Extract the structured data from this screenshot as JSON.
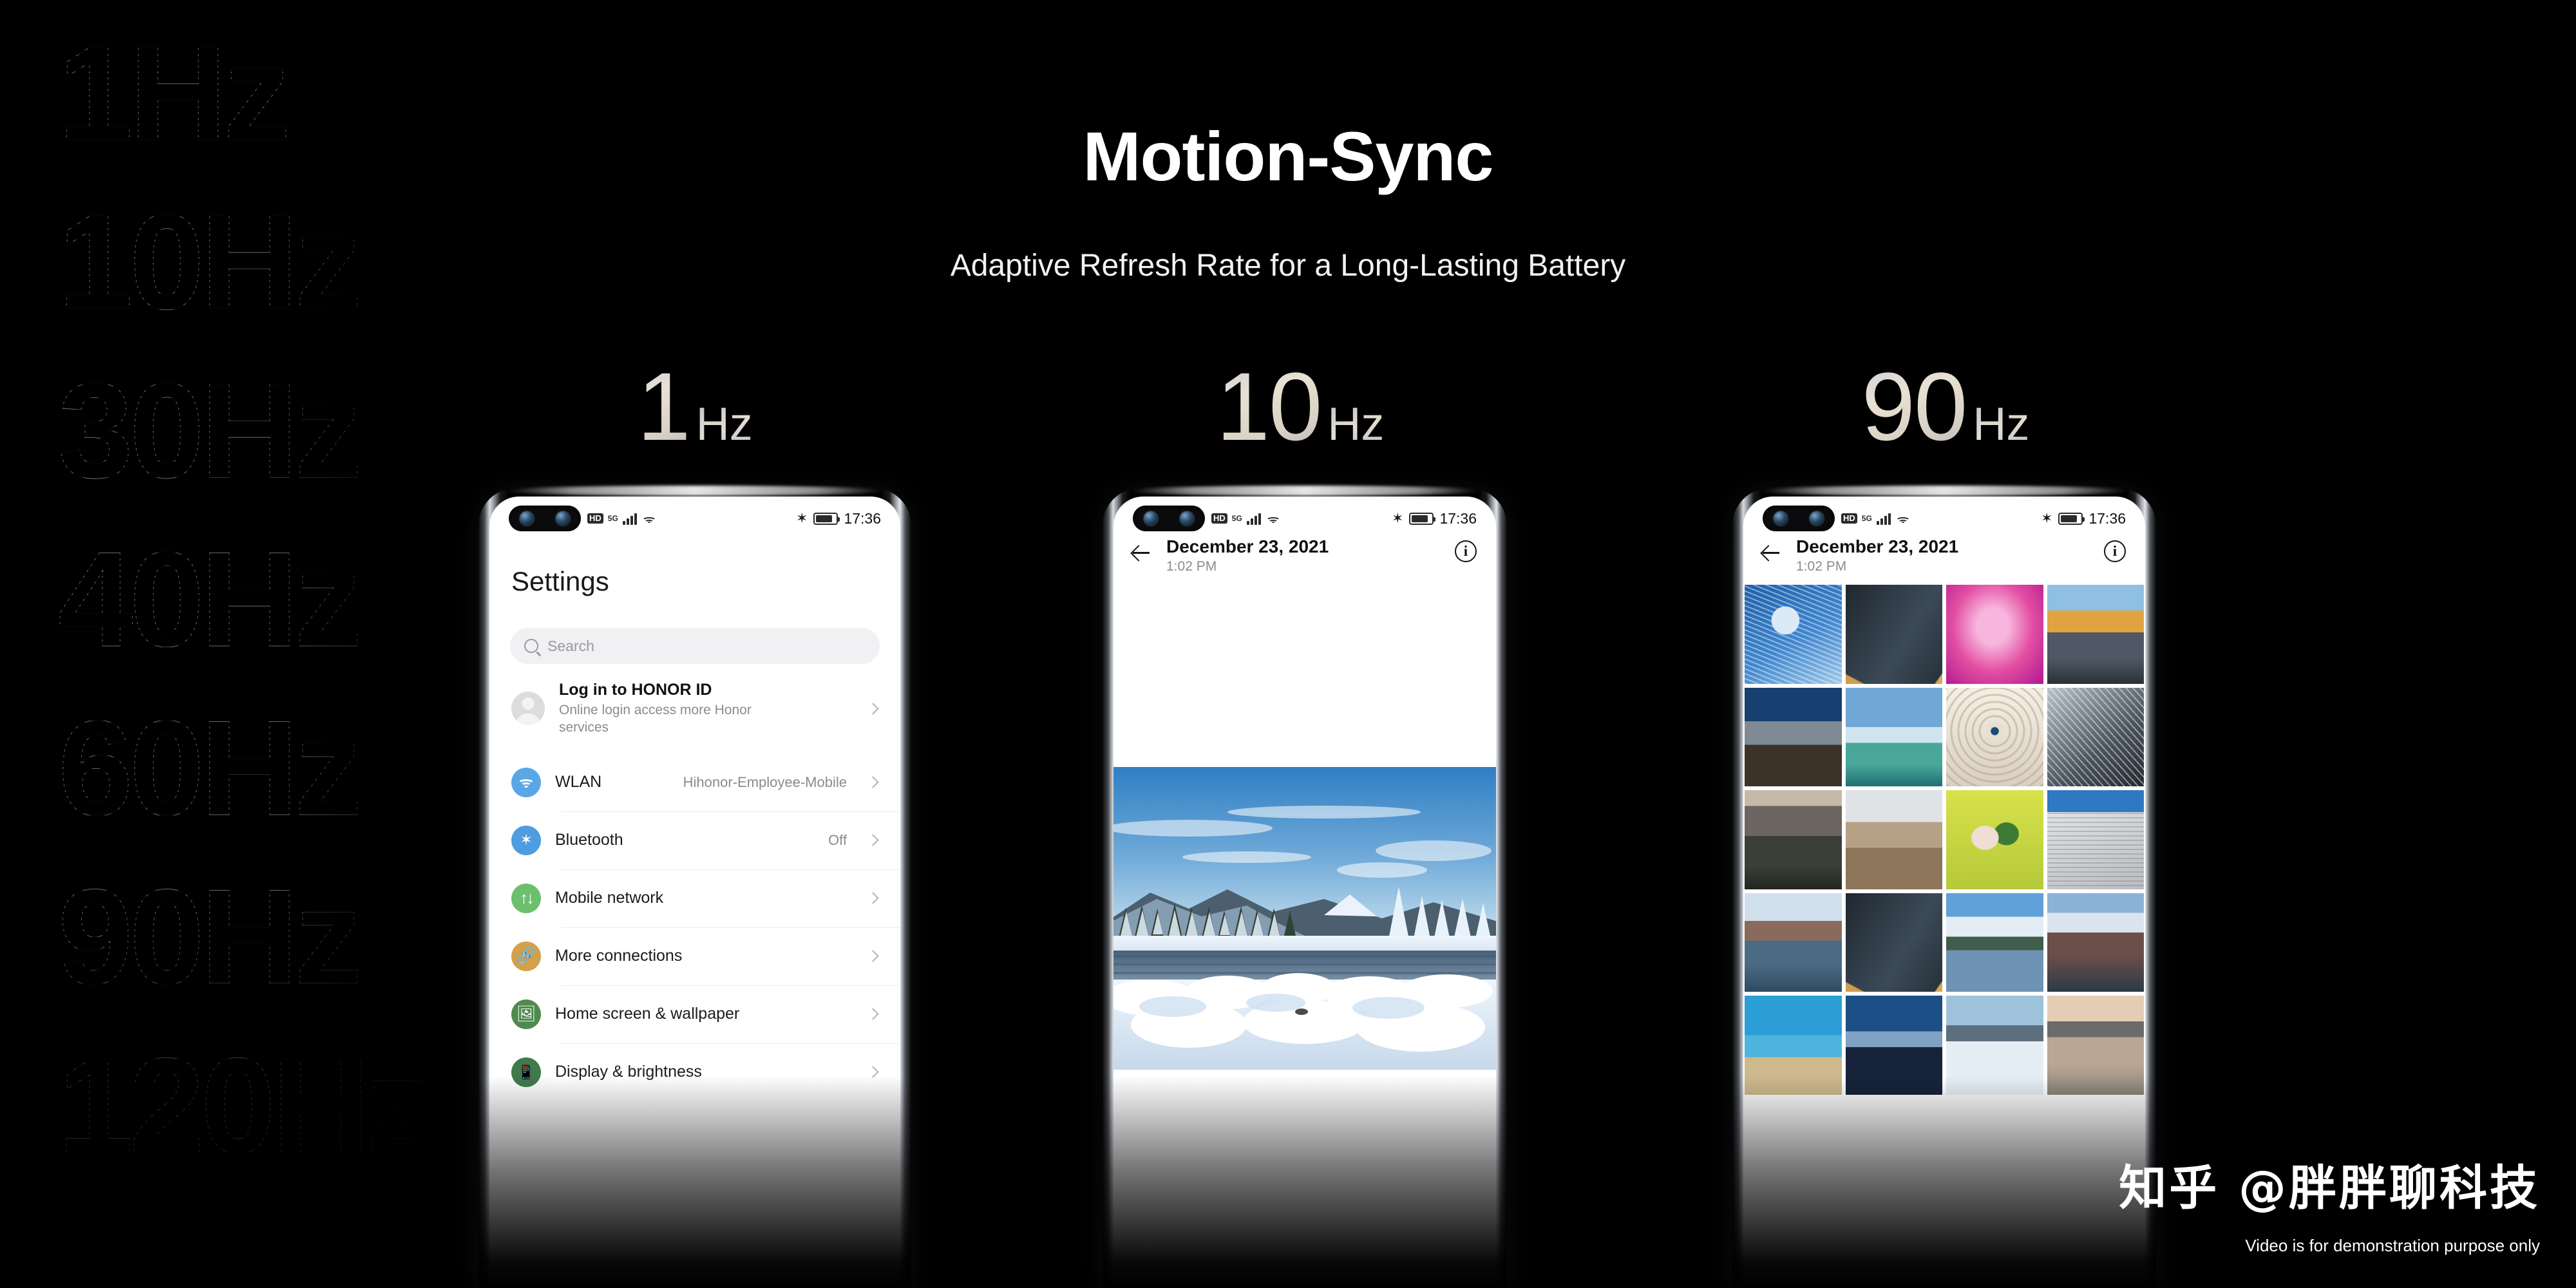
{
  "page": {
    "background": "#000000",
    "headline": "Motion-Sync",
    "subheadline": "Adaptive Refresh Rate for a Long-Lasting Battery",
    "watermark": "知乎 @胖胖聊科技",
    "disclaimer": "Video is for demonstration purpose only"
  },
  "decorative_rates": [
    {
      "label": "1Hz"
    },
    {
      "label": "10Hz"
    },
    {
      "label": "30Hz"
    },
    {
      "label": "40Hz"
    },
    {
      "label": "60Hz"
    },
    {
      "label": "90Hz"
    },
    {
      "label": "120Hz"
    }
  ],
  "rate_labels": [
    {
      "number": "1",
      "unit": "Hz"
    },
    {
      "number": "10",
      "unit": "Hz"
    },
    {
      "number": "90",
      "unit": "Hz"
    }
  ],
  "status_bar": {
    "hd_badge": "HD",
    "network": "5G",
    "signal_icon": "signal-bars-icon",
    "wifi_icon": "wifi-icon",
    "bluetooth_icon": "bluetooth-icon",
    "battery_icon": "battery-icon",
    "time": "17:36"
  },
  "phone1": {
    "screen_name": "settings",
    "title": "Settings",
    "search": {
      "placeholder": "Search",
      "icon": "search-icon"
    },
    "account": {
      "title": "Log in to HONOR ID",
      "subtitle": "Online login access more Honor services",
      "avatar": "avatar-icon",
      "chevron": "chevron-right-icon"
    },
    "rows": [
      {
        "label": "WLAN",
        "value": "Hihonor-Employee-Mobile",
        "icon": "wifi-icon",
        "color": "#5aa7e8"
      },
      {
        "label": "Bluetooth",
        "value": "Off",
        "icon": "bluetooth-icon",
        "color": "#4d9de0"
      },
      {
        "label": "Mobile network",
        "value": "",
        "icon": "mobile-network-icon",
        "color": "#6cbf6c"
      },
      {
        "label": "More connections",
        "value": "",
        "icon": "link-icon",
        "color": "#d4a04a"
      },
      {
        "label": "Home screen & wallpaper",
        "value": "",
        "icon": "image-icon",
        "color": "#4f8a4f"
      },
      {
        "label": "Display & brightness",
        "value": "",
        "icon": "brightness-icon",
        "color": "#3f7a4a"
      }
    ]
  },
  "phone2": {
    "screen_name": "photo-detail",
    "date": "December 23, 2021",
    "time": "1:02 PM",
    "back_icon": "back-arrow-icon",
    "info_icon": "info-icon",
    "photo_caption": "snowy-winter-lake-landscape"
  },
  "phone3": {
    "screen_name": "gallery-grid",
    "date": "December 23, 2021",
    "time": "1:02 PM",
    "back_icon": "back-arrow-icon",
    "info_icon": "info-icon",
    "grid": {
      "columns": 4,
      "rows": 5
    },
    "thumbnails": [
      "blue-dome-architecture",
      "aerial-city-interchange",
      "pink-tulip-macro",
      "golden-mountain-peak",
      "city-skyline-bridge",
      "surfer-on-wave",
      "eye-tunnel-spiral",
      "steel-structure-abstract",
      "dark-mountain-crater",
      "desert-canyon-aerial",
      "anthurium-in-vase",
      "white-modern-building",
      "coastal-fjord-village",
      "aerial-city-interchange",
      "snow-peak-reflection",
      "alpine-glacier-ridge",
      "coral-reef-underwater",
      "night-city-skyline",
      "snow-dunes-plain",
      "sunset-beach-horizon"
    ]
  }
}
